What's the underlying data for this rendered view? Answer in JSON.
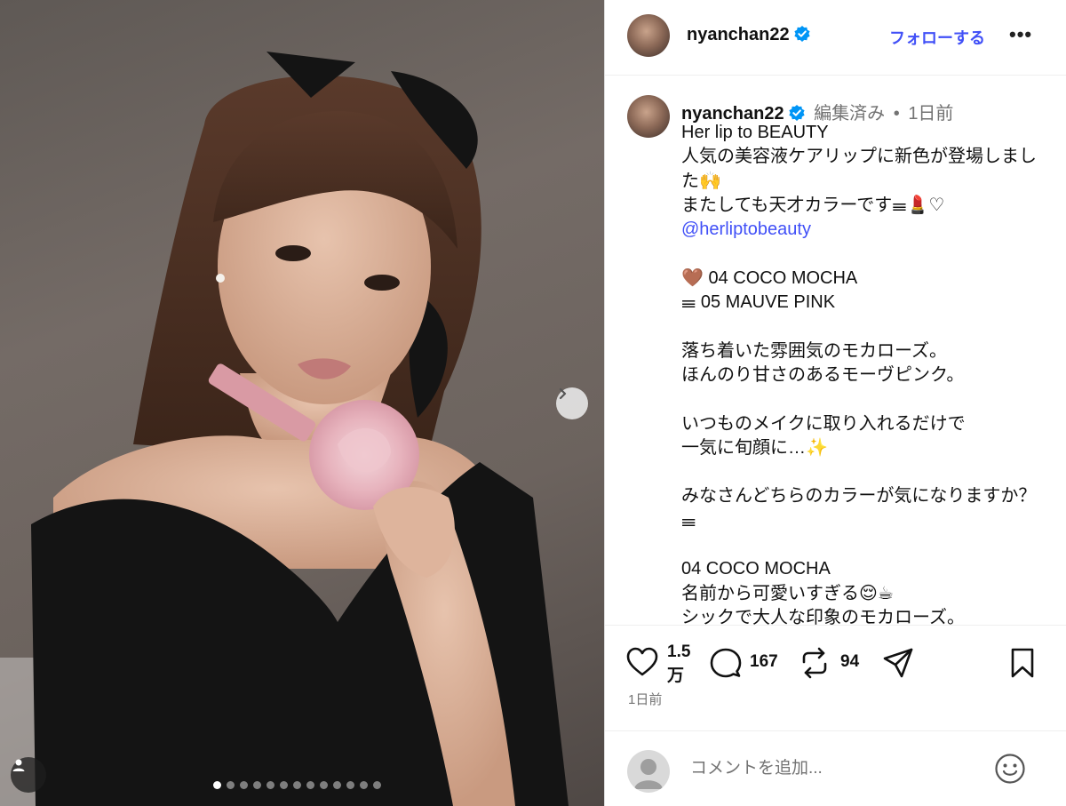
{
  "post": {
    "username": "nyanchan22",
    "follow_label": "フォローする",
    "more_label": "•••"
  },
  "caption": {
    "username": "nyanchan22",
    "edited": "編集済み",
    "separator": "•",
    "time": "1日前",
    "lines": [
      "Her lip to BEAUTY",
      "人気の美容液ケアリップに新色が登場しまし",
      "た🙌",
      "またしても天才カラーです𝍢💄♡",
      "@herliptobeauty",
      "",
      "🤎 04 COCO MOCHA",
      "𝍢 05 MAUVE PINK",
      "",
      "落ち着いた雰囲気のモカローズ。",
      "ほんのり甘さのあるモーヴピンク。",
      "",
      "いつものメイクに取り入れるだけで",
      "一気に旬顔に…✨",
      "",
      "みなさんどちらのカラーが気になりますか？",
      "𝍢",
      "",
      " 04 COCO MOCHA",
      "名前から可愛いすぎる😌☕",
      "シックで大人な印象のモカローズ。"
    ]
  },
  "stats": {
    "likes_line1": "1.5",
    "likes_line2": "万",
    "comments": "167",
    "reposts": "94",
    "time_ago": "1日前"
  },
  "comment": {
    "placeholder": "コメントを追加..."
  },
  "carousel": {
    "total": 13,
    "current": 1
  },
  "colors": {
    "accent": "#4150f7",
    "verified": "#0095f6",
    "muted": "#737373"
  }
}
